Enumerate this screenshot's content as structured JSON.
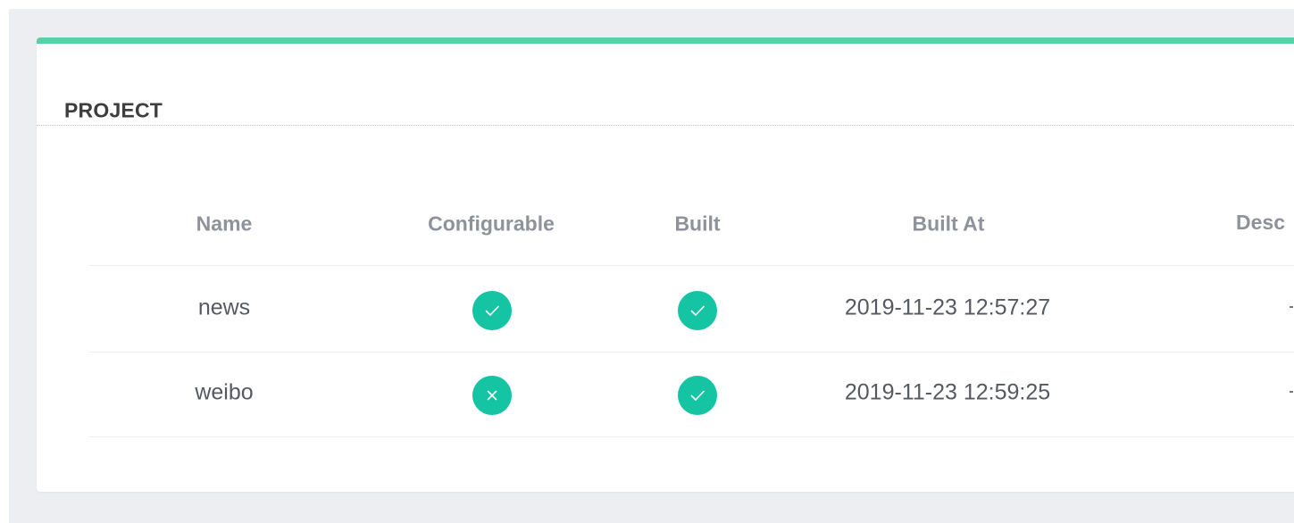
{
  "card": {
    "title": "PROJECT",
    "accent_color": "#5ad0a6"
  },
  "table": {
    "headers": {
      "name": "Name",
      "configurable": "Configurable",
      "built": "Built",
      "built_at": "Built At",
      "description": "Desc"
    },
    "rows": [
      {
        "name": "news",
        "configurable": true,
        "configurable_icon": "check-icon",
        "built": true,
        "built_icon": "check-icon",
        "built_at": "2019-11-23 12:57:27"
      },
      {
        "name": "weibo",
        "configurable": false,
        "configurable_icon": "close-icon",
        "built": true,
        "built_icon": "check-icon",
        "built_at": "2019-11-23 12:59:25"
      }
    ]
  },
  "colors": {
    "status_icon_bg": "#15c4a2",
    "page_background": "#edeef2"
  }
}
